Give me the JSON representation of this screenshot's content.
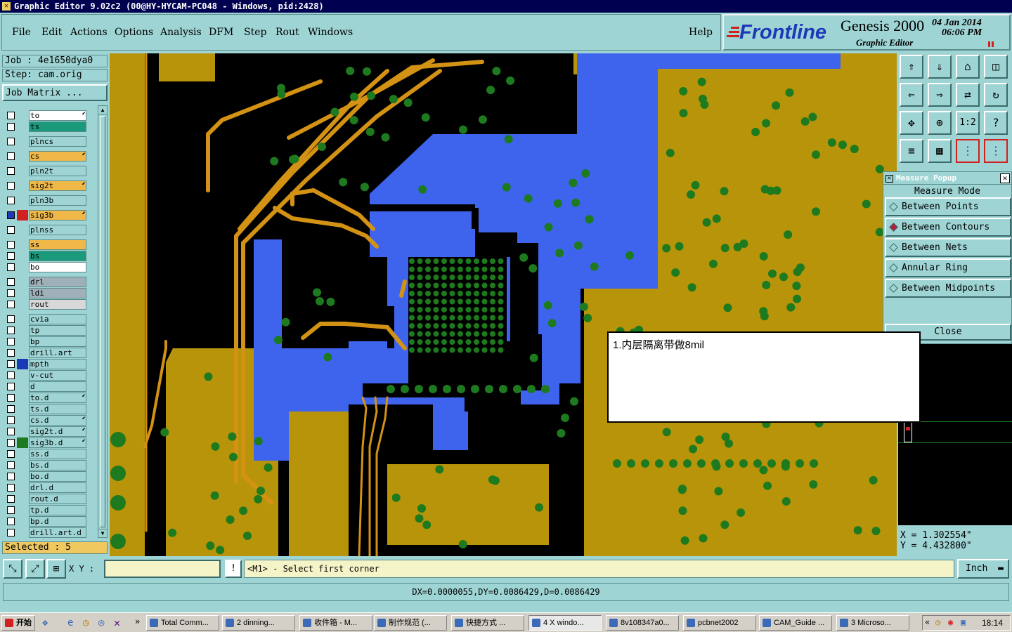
{
  "window": {
    "title": "Graphic Editor 9.02c2 (00@HY-HYCAM-PC048 - Windows, pid:2428)"
  },
  "menu": [
    "File",
    "Edit",
    "Actions",
    "Options",
    "Analysis",
    "DFM",
    "Step",
    "Rout",
    "Windows"
  ],
  "help": "Help",
  "brand": {
    "logo": "Frontline",
    "product": "Genesis 2000",
    "subtitle": "Graphic Editor",
    "date": "04 Jan 2014",
    "time": "06:06 PM"
  },
  "job": {
    "job": "Job : 4e1650dya0",
    "step": "Step: cam.orig",
    "matrix_button": "Job Matrix ..."
  },
  "layers": [
    {
      "name": "to",
      "color": "#ffffff",
      "arrow": true
    },
    {
      "name": "ts",
      "color": "#1a9a7a",
      "arrow": false
    },
    {
      "name": "plncs",
      "color": "#9fd4d4",
      "arrow": false
    },
    {
      "name": "cs",
      "color": "#f0b848",
      "arrow": true
    },
    {
      "name": "pln2t",
      "color": "#9fd4d4",
      "arrow": false
    },
    {
      "name": "sig2t",
      "color": "#f0b848",
      "arrow": true
    },
    {
      "name": "pln3b",
      "color": "#9fd4d4",
      "arrow": false
    },
    {
      "name": "sig3b",
      "color": "#f0b848",
      "arrow": true
    },
    {
      "name": "plnss",
      "color": "#9fd4d4",
      "arrow": false
    },
    {
      "name": "ss",
      "color": "#f0b848",
      "arrow": false
    },
    {
      "name": "bs",
      "color": "#1a9a7a",
      "arrow": false
    },
    {
      "name": "bo",
      "color": "#ffffff",
      "arrow": false
    },
    {
      "name": "drl",
      "color": "#a0b0b8",
      "arrow": false
    },
    {
      "name": "ldi",
      "color": "#a0b0b8",
      "arrow": false
    },
    {
      "name": "rout",
      "color": "#d8d8d8",
      "arrow": false
    },
    {
      "name": "cvia",
      "color": "#9fd4d4",
      "arrow": false
    },
    {
      "name": "tp",
      "color": "#9fd4d4",
      "arrow": false
    },
    {
      "name": "bp",
      "color": "#9fd4d4",
      "arrow": false
    },
    {
      "name": "drill.art",
      "color": "#9fd4d4",
      "arrow": false
    },
    {
      "name": "mpth",
      "color": "#9fd4d4",
      "arrow": false
    },
    {
      "name": "v-cut",
      "color": "#9fd4d4",
      "arrow": false
    },
    {
      "name": "d",
      "color": "#9fd4d4",
      "arrow": false
    },
    {
      "name": "to.d",
      "color": "#9fd4d4",
      "arrow": true
    },
    {
      "name": "ts.d",
      "color": "#9fd4d4",
      "arrow": false
    },
    {
      "name": "cs.d",
      "color": "#9fd4d4",
      "arrow": true
    },
    {
      "name": "sig2t.d",
      "color": "#9fd4d4",
      "arrow": true
    },
    {
      "name": "sig3b.d",
      "color": "#9fd4d4",
      "arrow": true
    },
    {
      "name": "ss.d",
      "color": "#9fd4d4",
      "arrow": false
    },
    {
      "name": "bs.d",
      "color": "#9fd4d4",
      "arrow": false
    },
    {
      "name": "bo.d",
      "color": "#9fd4d4",
      "arrow": false
    },
    {
      "name": "drl.d",
      "color": "#9fd4d4",
      "arrow": false
    },
    {
      "name": "rout.d",
      "color": "#9fd4d4",
      "arrow": false
    },
    {
      "name": "tp.d",
      "color": "#9fd4d4",
      "arrow": false
    },
    {
      "name": "bp.d",
      "color": "#9fd4d4",
      "arrow": false
    },
    {
      "name": "drill.art.d",
      "color": "#9fd4d4",
      "arrow": false
    }
  ],
  "selected": "Selected : 5",
  "measure": {
    "title": "Measure Popup",
    "mode_label": "Measure Mode",
    "options": [
      "Between Points",
      "Between Contours",
      "Between Nets",
      "Annular Ring",
      "Between Midpoints"
    ],
    "selected_index": 1,
    "close": "Close"
  },
  "coords": {
    "x": "X = 1.302554\"",
    "y": "Y = 4.432800\""
  },
  "note": "1.内层隔离带做8mil",
  "command": {
    "xy_label": "X Y :",
    "xy_value": "",
    "excl": "!",
    "prompt": "<M1> - Select first corner",
    "units": "Inch"
  },
  "status": "DX=0.0000055,DY=0.0086429,D=0.0086429",
  "taskbar": {
    "start": "开始",
    "tasks": [
      "Total Comm...",
      "2 dinning...",
      "收件箱 - M...",
      "制作规范 (...",
      "快捷方式 ...",
      "4 X windo...",
      "8v108347a0...",
      "pcbnet2002",
      "CAM_Guide ...",
      "3 Microso..."
    ],
    "clock": "18:14"
  },
  "colors": {
    "copper": "#b8940a",
    "plane": "#3e64ee",
    "pad": "#1e7a1e",
    "trace": "#d49214",
    "bg": "#000000"
  }
}
